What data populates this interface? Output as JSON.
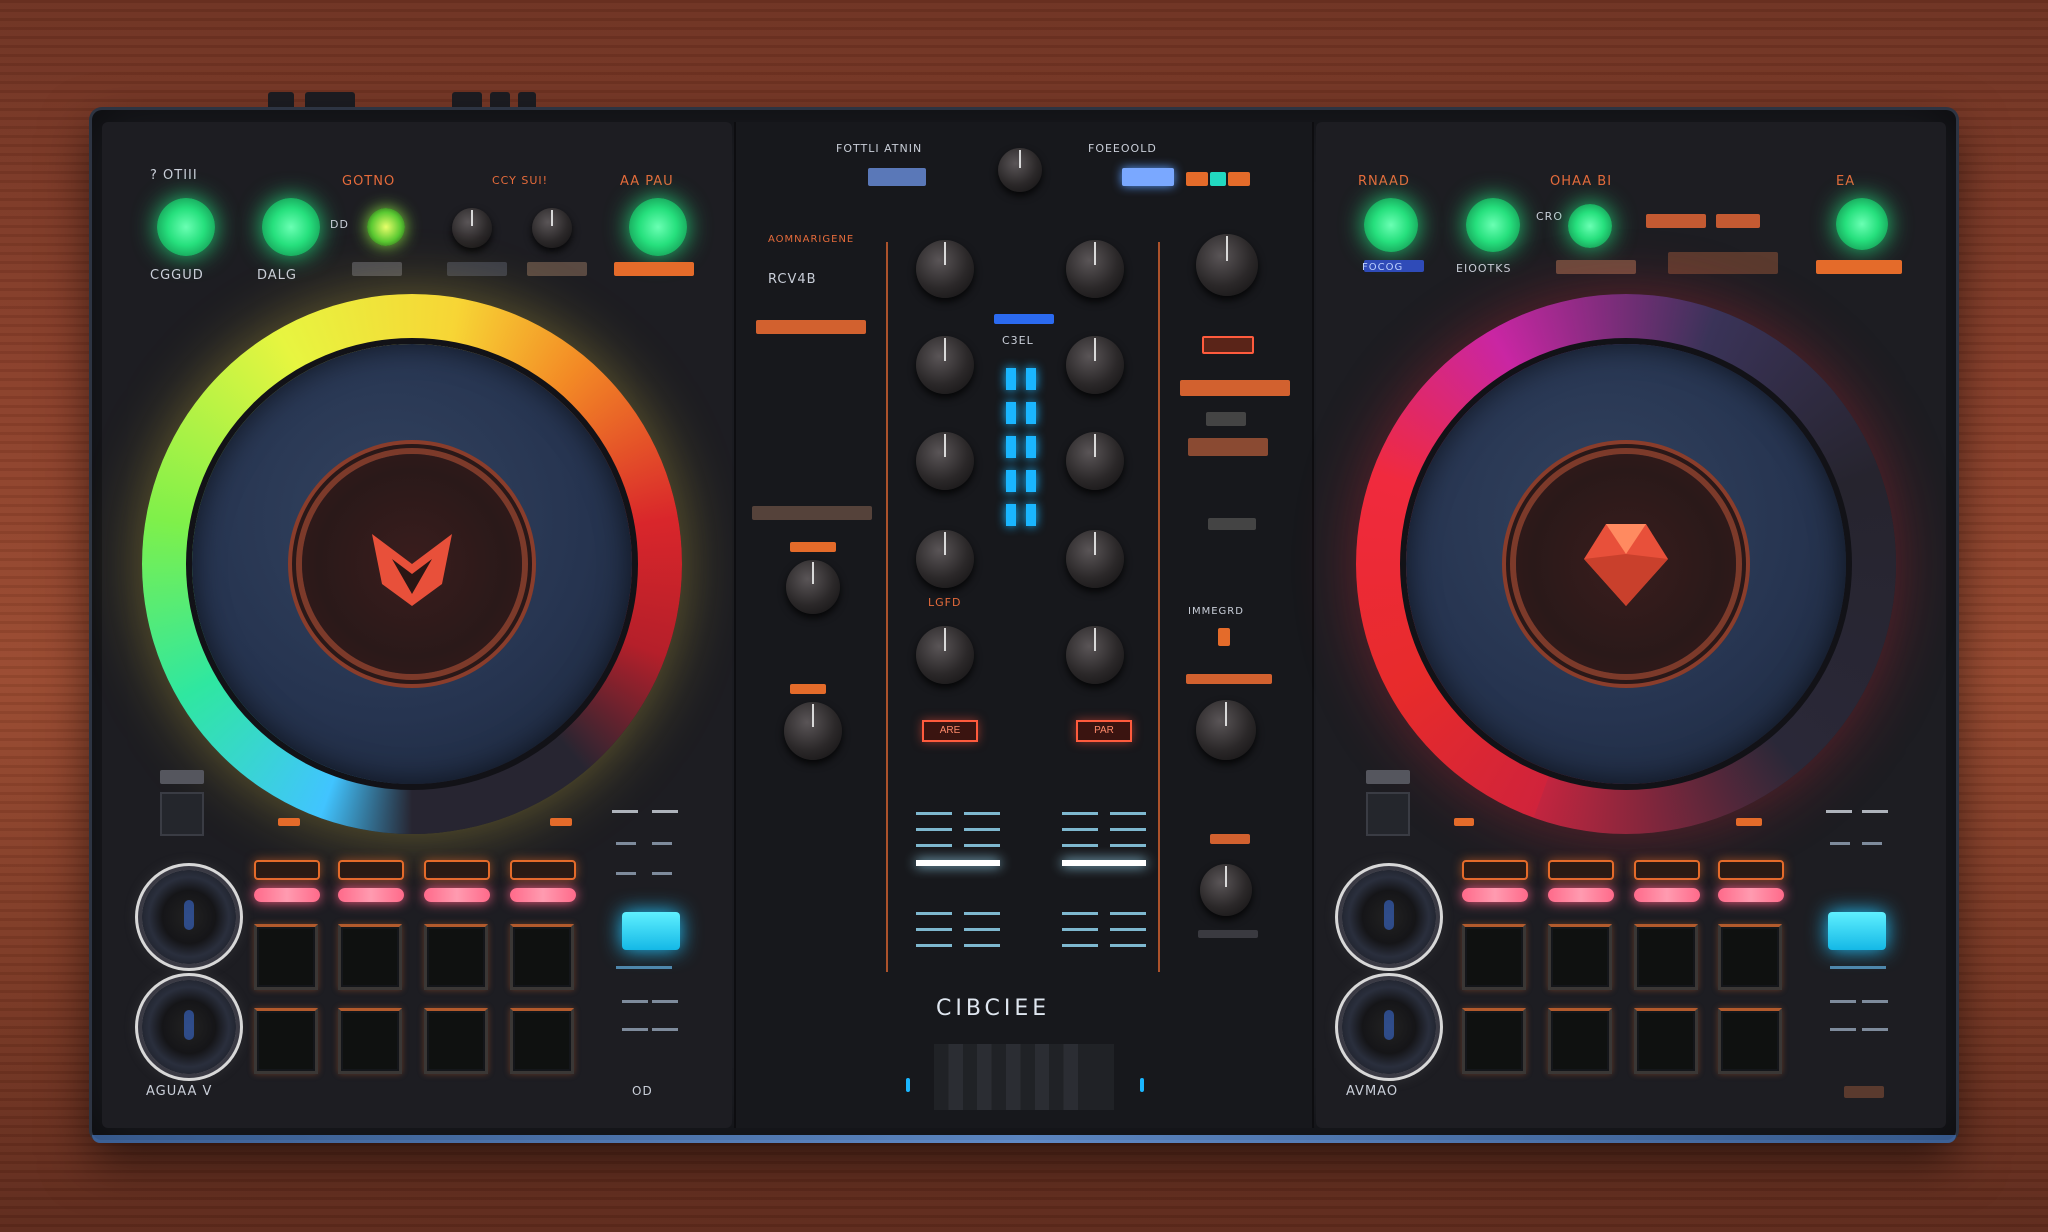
{
  "deck_a": {
    "top_labels": [
      "? OTIII",
      "GOTNO",
      "CCY SUI!",
      "AA PAU"
    ],
    "small_labels": [
      "DD"
    ],
    "btn_labels": [
      "CGGUD",
      "DALG"
    ],
    "bottom_label": "AGUAA V",
    "bottom_right": "OD",
    "pads_top": [
      "",
      "",
      "",
      ""
    ]
  },
  "deck_b": {
    "top_labels": [
      "RNAAD",
      "OHAA BI",
      "EA"
    ],
    "small_label": "CRO",
    "btn_labels": [
      "FOCOG",
      "EIOOTKS"
    ],
    "bottom_label": "AVMAO"
  },
  "mixer": {
    "top_left": "FOTTLI ATNIN",
    "top_right": "FOEEOOLD",
    "ch_label": "C3EL",
    "cue_left": "ARE",
    "cue_right": "PAR",
    "left_labels": [
      "RCV4B"
    ],
    "mid_label": "LGFD",
    "right_label": "IMMEGRD",
    "brand": "CIBCIEE"
  },
  "colors": {
    "accent": "#e46b2a",
    "green": "#26e07d",
    "cyan": "#1ab6ff",
    "pink": "#ff6a8a"
  },
  "icons": {
    "jog_logo": "fox-logo-icon",
    "deck_b_logo": "gem-logo-icon"
  }
}
